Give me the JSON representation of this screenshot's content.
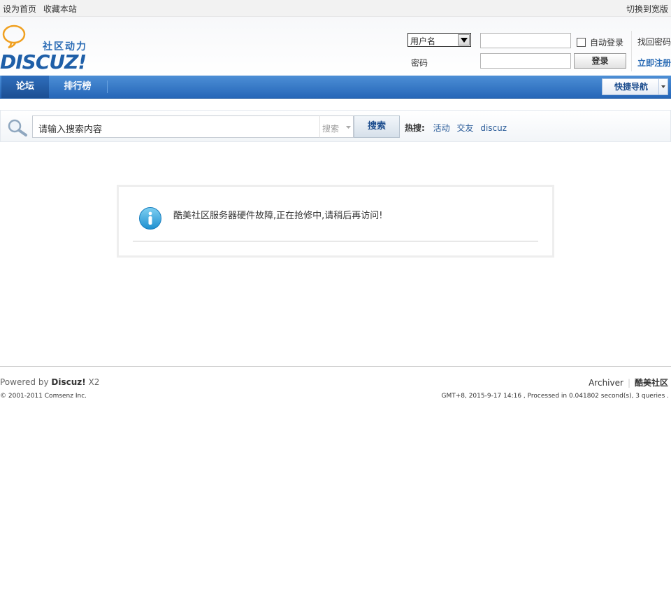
{
  "topbar": {
    "set_homepage": "设为首页",
    "bookmark": "收藏本站",
    "switch_wide": "切换到宽版"
  },
  "logo": {
    "slogan": "社区动力",
    "word": "DISCUZ!"
  },
  "login": {
    "username_select": "用户名",
    "password_label": "密码",
    "auto_login": "自动登录",
    "login_button": "登录",
    "forgot_password": "找回密码",
    "register": "立即注册",
    "username_value": "",
    "password_value": ""
  },
  "nav": {
    "forum": "论坛",
    "ranking": "排行榜",
    "quick_nav": "快捷导航"
  },
  "search": {
    "placeholder": "请输入搜索内容",
    "type": "搜索",
    "button": "搜索",
    "hot_label": "热搜:",
    "hot_keywords": [
      "活动",
      "交友",
      "discuz"
    ]
  },
  "message": {
    "text": "酷美社区服务器硬件故障,正在抢修中,请稍后再访问!"
  },
  "footer": {
    "powered_prefix": "Powered by ",
    "powered_brand": "Discuz!",
    "powered_version": " X2",
    "copyright": "© 2001-2011 Comsenz Inc.",
    "archiver": "Archiver",
    "site_name": "酷美社区",
    "stats": "GMT+8, 2015-9-17 14:16 , Processed in 0.041802 second(s), 3 queries ."
  },
  "colors": {
    "accent_blue": "#2566b8",
    "link_blue": "#2b6cb5"
  }
}
